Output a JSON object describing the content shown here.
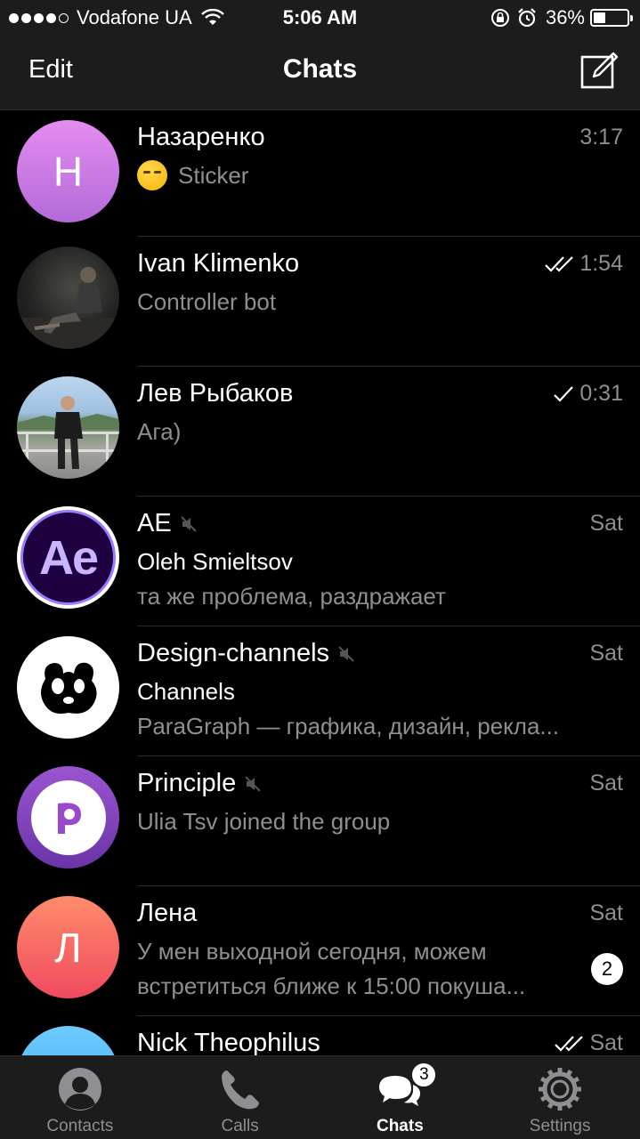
{
  "status_bar": {
    "carrier": "Vodafone UA",
    "time": "5:06 AM",
    "battery_percent": "36%",
    "battery_level": 0.36,
    "signal_bars": 4,
    "icons": [
      "signal-icon",
      "wifi-icon",
      "rotation-lock-icon",
      "alarm-icon",
      "battery-icon"
    ]
  },
  "nav": {
    "edit_label": "Edit",
    "title": "Chats",
    "compose_icon": "compose-icon"
  },
  "chats": [
    {
      "name": "Назаренко",
      "time": "3:17",
      "avatar_letter": "Н",
      "avatar_colors": [
        "#e58cf0",
        "#b36ad8"
      ],
      "line1": "Sticker",
      "line1_emoji": "unamused-face"
    },
    {
      "name": "Ivan Klimenko",
      "time": "1:54",
      "status": "read",
      "avatar_type": "photo",
      "line1": "Controller bot"
    },
    {
      "name": "Лев Рыбаков",
      "time": "0:31",
      "status": "sent",
      "avatar_type": "photo",
      "line1": "Ага)"
    },
    {
      "name": "AE",
      "time": "Sat",
      "muted": true,
      "avatar_text": "Ae",
      "avatar_colors": [
        "#1a0033",
        "#9a7bff"
      ],
      "line1": "Oleh Smieltsov",
      "line2": "та же проблема, раздражает"
    },
    {
      "name": "Design-channels",
      "time": "Sat",
      "muted": true,
      "avatar_type": "logo",
      "line1": "Channels",
      "line2": "ParaGraph — графика, дизайн, рекла..."
    },
    {
      "name": "Principle",
      "time": "Sat",
      "muted": true,
      "avatar_type": "logo",
      "avatar_colors": [
        "#7b3fb4",
        "#b65fd8"
      ],
      "line1": "Ulia Tsv joined the group"
    },
    {
      "name": "Лена",
      "time": "Sat",
      "avatar_letter": "Л",
      "avatar_colors": [
        "#ff8c6b",
        "#f04a5f"
      ],
      "line1": "У мен выходной сегодня, можем",
      "line2": "встретиться ближе к 15:00 покуша...",
      "unread": "2"
    },
    {
      "name": "Nick Theophilus",
      "time": "Sat",
      "status": "read",
      "avatar_colors": [
        "#6ecbff",
        "#3fa7f5"
      ]
    }
  ],
  "tabs": [
    {
      "label": "Contacts",
      "icon": "contacts-icon"
    },
    {
      "label": "Calls",
      "icon": "phone-icon"
    },
    {
      "label": "Chats",
      "icon": "chats-icon",
      "badge": "3",
      "active": true
    },
    {
      "label": "Settings",
      "icon": "gear-icon"
    }
  ],
  "colors": {
    "background": "#000000",
    "bar_background": "#1c1c1c",
    "secondary_text": "#8e8e93",
    "divider": "#2a2a2a"
  }
}
